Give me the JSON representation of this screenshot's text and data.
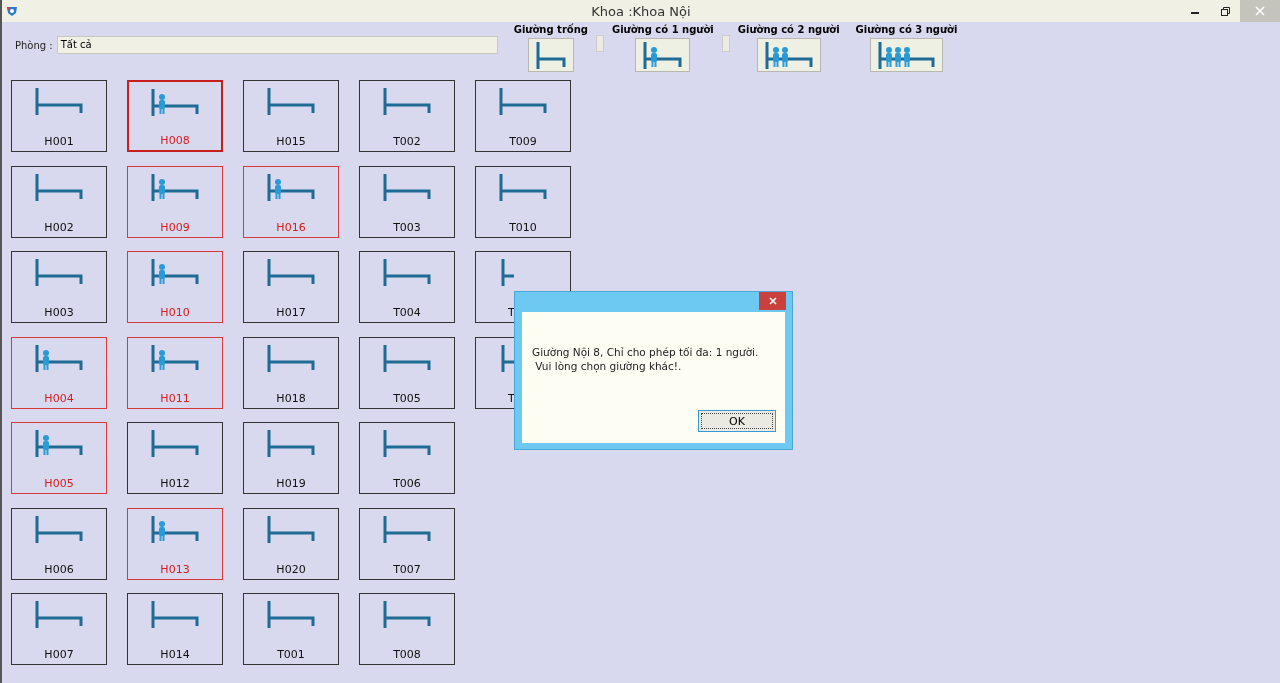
{
  "window": {
    "title": "Khoa :Khoa Nội"
  },
  "filter": {
    "label": "Phòng :",
    "value": "Tất cả"
  },
  "legend": [
    {
      "label": "Giường trống",
      "kind": "empty"
    },
    {
      "label": "Giường có 1 người",
      "kind": "one"
    },
    {
      "label": "Giường có 2 người",
      "kind": "two"
    },
    {
      "label": "Giường có 3 người",
      "kind": "three"
    }
  ],
  "beds": [
    {
      "label": "H001",
      "occupied": false,
      "selected": false
    },
    {
      "label": "H002",
      "occupied": false,
      "selected": false
    },
    {
      "label": "H003",
      "occupied": false,
      "selected": false
    },
    {
      "label": "H004",
      "occupied": true,
      "selected": false
    },
    {
      "label": "H005",
      "occupied": true,
      "selected": false
    },
    {
      "label": "H006",
      "occupied": false,
      "selected": false
    },
    {
      "label": "H007",
      "occupied": false,
      "selected": false
    },
    {
      "label": "H008",
      "occupied": true,
      "selected": true
    },
    {
      "label": "H009",
      "occupied": true,
      "selected": false
    },
    {
      "label": "H010",
      "occupied": true,
      "selected": false
    },
    {
      "label": "H011",
      "occupied": true,
      "selected": false
    },
    {
      "label": "H012",
      "occupied": false,
      "selected": false
    },
    {
      "label": "H013",
      "occupied": true,
      "selected": false
    },
    {
      "label": "H014",
      "occupied": false,
      "selected": false
    },
    {
      "label": "H015",
      "occupied": false,
      "selected": false
    },
    {
      "label": "H016",
      "occupied": true,
      "selected": false
    },
    {
      "label": "H017",
      "occupied": false,
      "selected": false
    },
    {
      "label": "H018",
      "occupied": false,
      "selected": false
    },
    {
      "label": "H019",
      "occupied": false,
      "selected": false
    },
    {
      "label": "H020",
      "occupied": false,
      "selected": false
    },
    {
      "label": "T001",
      "occupied": false,
      "selected": false
    },
    {
      "label": "T002",
      "occupied": false,
      "selected": false
    },
    {
      "label": "T003",
      "occupied": false,
      "selected": false
    },
    {
      "label": "T004",
      "occupied": false,
      "selected": false
    },
    {
      "label": "T005",
      "occupied": false,
      "selected": false
    },
    {
      "label": "T006",
      "occupied": false,
      "selected": false
    },
    {
      "label": "T007",
      "occupied": false,
      "selected": false
    },
    {
      "label": "T008",
      "occupied": false,
      "selected": false
    },
    {
      "label": "T009",
      "occupied": false,
      "selected": false
    },
    {
      "label": "T010",
      "occupied": false,
      "selected": false
    },
    {
      "label": "T",
      "occupied": false,
      "selected": false,
      "kind": "partial"
    },
    {
      "label": "T",
      "occupied": false,
      "selected": false,
      "kind": "partial"
    }
  ],
  "dialog": {
    "message": "Giường Nội 8, Chỉ cho phép tối đa: 1 người.\n Vui lòng chọn giường khác!.",
    "button": "OK"
  }
}
